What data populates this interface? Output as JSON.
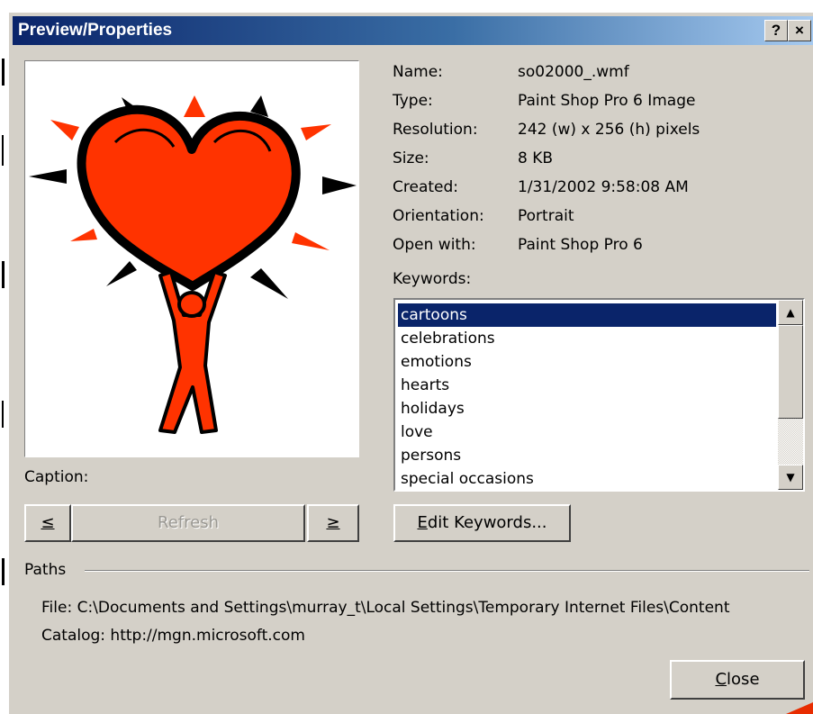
{
  "window": {
    "title": "Preview/Properties"
  },
  "titlebar_buttons": {
    "help": "?",
    "close": "×"
  },
  "properties": [
    {
      "key": "Name:",
      "value": "so02000_.wmf"
    },
    {
      "key": "Type:",
      "value": "Paint Shop Pro 6 Image"
    },
    {
      "key": "Resolution:",
      "value": "242 (w) x 256 (h) pixels"
    },
    {
      "key": "Size:",
      "value": "8 KB"
    },
    {
      "key": "Created:",
      "value": "1/31/2002 9:58:08 AM"
    },
    {
      "key": "Orientation:",
      "value": "Portrait"
    },
    {
      "key": "Open with:",
      "value": "Paint Shop Pro 6"
    }
  ],
  "keywords": {
    "label": "Keywords:",
    "items": [
      "cartoons",
      "celebrations",
      "emotions",
      "hearts",
      "holidays",
      "love",
      "persons",
      "special occasions"
    ],
    "selected": "cartoons"
  },
  "caption_label": "Caption:",
  "nav": {
    "prev": "≤",
    "refresh": "Refresh",
    "next": "≥"
  },
  "edit_keywords": {
    "prefix": "E",
    "rest": "dit Keywords..."
  },
  "paths": {
    "label": "Paths",
    "file": "File:  C:\\Documents and Settings\\murray_t\\Local Settings\\Temporary Internet Files\\Content",
    "catalog": "Catalog:  http://mgn.microsoft.com"
  },
  "close_button": {
    "prefix": "C",
    "rest": "lose"
  },
  "colors": {
    "accent": "#0a246a",
    "heart_red": "#ff3300",
    "face": "#d4d0c8"
  }
}
